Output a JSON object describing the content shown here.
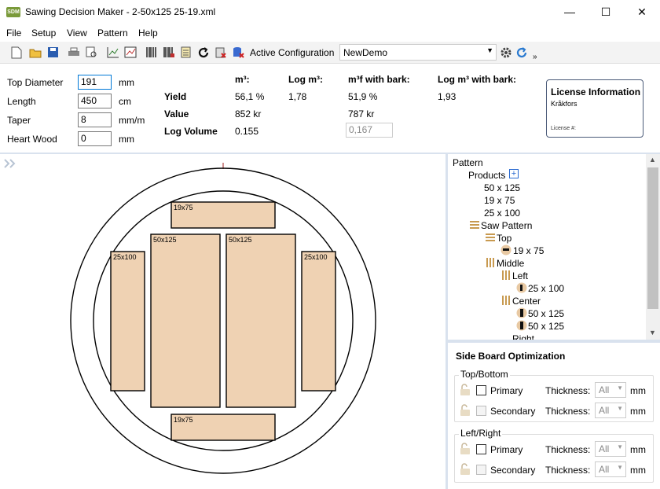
{
  "window": {
    "title": "Sawing Decision Maker - 2-50x125 25-19.xml",
    "logo": "SDM",
    "minimize": "—",
    "maximize": "☐",
    "close": "✕"
  },
  "menu": [
    "File",
    "Setup",
    "View",
    "Pattern",
    "Help"
  ],
  "toolbar": {
    "icons": [
      "new-icon",
      "open-icon",
      "save-icon",
      "print-icon",
      "print-preview-icon",
      "chart-icon",
      "chart2-icon",
      "barcode-icon",
      "barcode2-icon",
      "notes-icon",
      "refresh-icon",
      "delete-icon",
      "db-icon"
    ],
    "active_config_label": "Active Configuration",
    "config_value": "NewDemo",
    "more": "»"
  },
  "inputs": [
    {
      "label": "Top Diameter",
      "value": "191",
      "unit": "mm"
    },
    {
      "label": "Length",
      "value": "450",
      "unit": "cm"
    },
    {
      "label": "Taper",
      "value": "8",
      "unit": "mm/m"
    },
    {
      "label": "Heart Wood",
      "value": "0",
      "unit": "mm"
    }
  ],
  "results": {
    "headers": [
      "m³:",
      "Log m³:",
      "m³f with bark:",
      "Log m³ with bark:"
    ],
    "rows": [
      {
        "label": "Yield",
        "values": [
          "56,1 %",
          "1,78",
          "51,9 %",
          "1,93"
        ]
      },
      {
        "label": "Value",
        "values": [
          "852 kr",
          "",
          "787 kr",
          ""
        ]
      },
      {
        "label": "Log Volume",
        "values": [
          "0.155",
          "",
          "0,167",
          ""
        ]
      }
    ]
  },
  "license": {
    "title": "License Information",
    "company": "Kråkfors",
    "number_label": "License #:"
  },
  "tree": {
    "root": "Pattern",
    "products_label": "Products",
    "products": [
      "50 x 125",
      "19 x 75",
      "25 x 100"
    ],
    "saw_pattern": "Saw Pattern",
    "top": "Top",
    "top_item": "19 x 75",
    "middle": "Middle",
    "left": "Left",
    "left_item": "25 x 100",
    "center": "Center",
    "center_items": [
      "50 x 125",
      "50 x 125"
    ],
    "right": "Right"
  },
  "side_board": {
    "title": "Side Board Optimization",
    "groups": [
      {
        "title": "Top/Bottom",
        "rows": [
          {
            "label": "Primary",
            "thickness_label": "Thickness:",
            "value": "All",
            "unit": "mm"
          },
          {
            "label": "Secondary",
            "thickness_label": "Thickness:",
            "value": "All",
            "unit": "mm"
          }
        ]
      },
      {
        "title": "Left/Right",
        "rows": [
          {
            "label": "Primary",
            "thickness_label": "Thickness:",
            "value": "All",
            "unit": "mm"
          },
          {
            "label": "Secondary",
            "thickness_label": "Thickness:",
            "value": "All",
            "unit": "mm"
          }
        ]
      }
    ]
  },
  "diagram": {
    "boards": [
      "19x75",
      "50x125",
      "50x125",
      "25x100",
      "25x100",
      "19x75"
    ],
    "colors": {
      "board": "#efd2b3",
      "outline": "#000000",
      "bg": "#ffffff"
    }
  }
}
